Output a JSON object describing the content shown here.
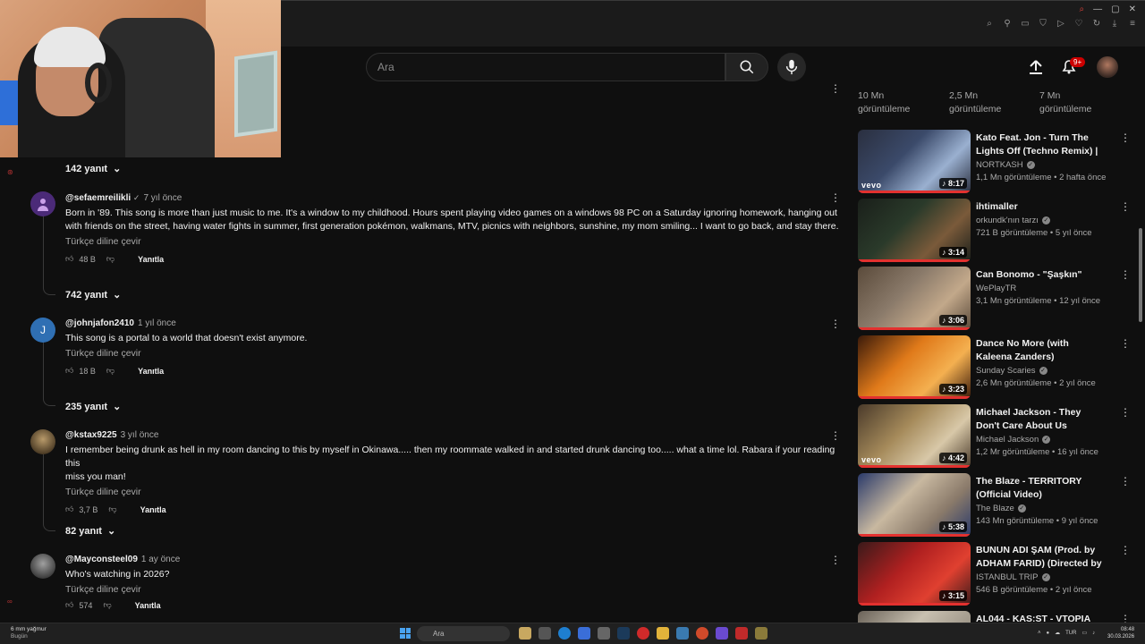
{
  "search": {
    "placeholder": "Ara"
  },
  "header": {
    "notification_badge": "9+"
  },
  "comments": [
    {
      "replies_above": "142 yanıt",
      "author": "@sefaemreilikli",
      "time": "7 yıl önce",
      "avatar_letter": "",
      "avatar_color": "#4b2a78",
      "text_lines": [
        "Born in '89. This song is more than just music to me. It's a window to my childhood. Hours spent playing video games on a windows 98 PC on a Saturday ignoring homework, hanging out",
        "with friends on the street, having water fights in summer, first generation pokémon, walkmans, MTV, picnics with neighbors, sunshine, my mom smiling... I want to go back, and stay there."
      ],
      "translate": "Türkçe diline çevir",
      "likes": "48 B",
      "reply_label": "Yanıtla"
    },
    {
      "replies_above": "742 yanıt",
      "author": "@johnjafon2410",
      "time": "1 yıl önce",
      "avatar_letter": "J",
      "avatar_color": "#2f6fb3",
      "text_lines": [
        "This song is a portal to a world that doesn't exist anymore."
      ],
      "translate": "Türkçe diline çevir",
      "likes": "18 B",
      "reply_label": "Yanıtla"
    },
    {
      "replies_above": "235 yanıt",
      "author": "@kstax9225",
      "time": "3 yıl önce",
      "avatar_letter": "",
      "avatar_color": "#6b5a3a",
      "text_lines": [
        "I remember being drunk as hell in my room dancing to this by myself in Okinawa..... then my roommate walked in and started drunk dancing too..... what a time lol. Rabara if your reading this",
        "miss you man!"
      ],
      "translate": "Türkçe diline çevir",
      "likes": "3,7 B",
      "reply_label": "Yanıtla"
    },
    {
      "replies_above": "82 yanıt",
      "author": "@Mayconsteel09",
      "time": "1 ay önce",
      "avatar_letter": "",
      "avatar_color": "#7a7a7a",
      "text_lines": [
        "Who's watching in 2026?"
      ],
      "translate": "Türkçe diline çevir",
      "likes": "574",
      "reply_label": "Yanıtla"
    }
  ],
  "sidebar": {
    "top_stats": [
      {
        "count": "10 Mn",
        "label": "görüntüleme"
      },
      {
        "count": "2,5 Mn",
        "label": "görüntüleme"
      },
      {
        "count": "7 Mn",
        "label": "görüntüleme"
      }
    ],
    "recommendations": [
      {
        "title": "Kato Feat. Jon - Turn The Lights Off (Techno Remix) | Jon Ham...",
        "channel": "NORTKASH",
        "verified": true,
        "meta": "1,1 Mn görüntüleme • 2 hafta önce",
        "duration": "8:17",
        "vevo": "vevo",
        "colors": [
          "#3b4a6a",
          "#9ab0d0",
          "#2a2f3f"
        ]
      },
      {
        "title": "ihtimaller",
        "channel": "orkundk'nın tarzı",
        "verified": true,
        "meta": "721 B görüntüleme • 5 yıl önce",
        "duration": "3:14",
        "vevo": "",
        "colors": [
          "#2a3a2a",
          "#7a5a3a",
          "#1a1f1a"
        ]
      },
      {
        "title": "Can Bonomo - \"Şaşkın\"",
        "channel": "WePlayTR",
        "verified": false,
        "meta": "3,1 Mn görüntüleme • 12 yıl önce",
        "duration": "3:06",
        "vevo": "",
        "colors": [
          "#8a7a6a",
          "#c2a88a",
          "#5a4a3a"
        ]
      },
      {
        "title": "Dance No More (with Kaleena Zanders)",
        "channel": "Sunday Scaries",
        "verified": true,
        "meta": "2,6 Mn görüntüleme • 2 yıl önce",
        "duration": "3:23",
        "vevo": "",
        "colors": [
          "#e07a1a",
          "#f4b050",
          "#3a1a0a"
        ]
      },
      {
        "title": "Michael Jackson - They Don't Care About Us",
        "channel": "Michael Jackson",
        "verified": true,
        "meta": "1,2 Mr görüntüleme • 16 yıl önce",
        "duration": "4:42",
        "vevo": "vevo",
        "colors": [
          "#a58a5a",
          "#d8c8a8",
          "#4a3a2a"
        ]
      },
      {
        "title": "The Blaze - TERRITORY (Official Video)",
        "channel": "The Blaze",
        "verified": true,
        "meta": "143 Mn görüntüleme • 9 yıl önce",
        "duration": "5:38",
        "vevo": "",
        "colors": [
          "#c8b8a0",
          "#8a7a6a",
          "#2a3a6a"
        ]
      },
      {
        "title": "BUNUN ADI ŞAM (Prod. by ADHAM FARID) (Directed by ...",
        "channel": "ISTANBUL TRIP",
        "verified": true,
        "meta": "546 B görüntüleme • 2 yıl önce",
        "duration": "3:15",
        "vevo": "",
        "colors": [
          "#b02020",
          "#e04030",
          "#3a1a1a"
        ]
      },
      {
        "title": "AL044 - KAS:ST - VTOPIA",
        "channel": "",
        "verified": false,
        "meta": "",
        "duration": "",
        "vevo": "",
        "colors": [
          "#c8c0b0",
          "#a0988a",
          "#6a6258"
        ]
      }
    ]
  },
  "taskbar": {
    "weather_line1": "6 mm yağmur",
    "weather_line2": "Bugün",
    "search_label": "Ara",
    "lang": "TUR",
    "time": "08:48",
    "date": "30.03.2026"
  }
}
